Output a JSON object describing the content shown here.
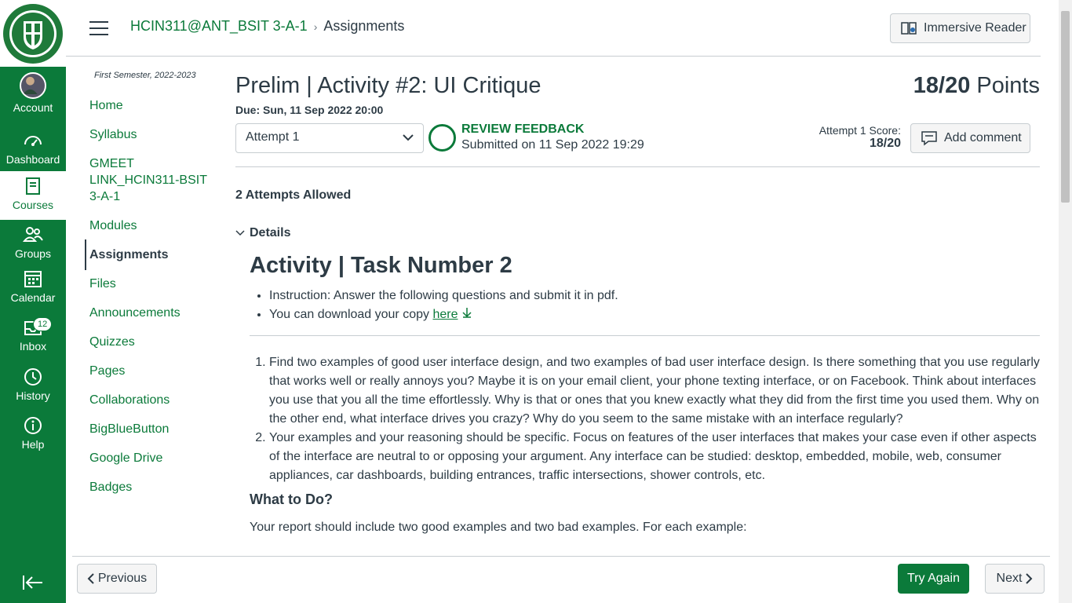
{
  "global_nav": {
    "items": [
      {
        "label": "Account",
        "icon": "avatar-icon"
      },
      {
        "label": "Dashboard",
        "icon": "dashboard-icon"
      },
      {
        "label": "Courses",
        "icon": "courses-icon"
      },
      {
        "label": "Groups",
        "icon": "groups-icon"
      },
      {
        "label": "Calendar",
        "icon": "calendar-icon"
      },
      {
        "label": "Inbox",
        "icon": "inbox-icon",
        "badge": "12"
      },
      {
        "label": "History",
        "icon": "history-icon"
      },
      {
        "label": "Help",
        "icon": "help-icon"
      }
    ],
    "active": "Courses",
    "accent": "#0b7a3a"
  },
  "breadcrumb": {
    "course": "HCIN311@ANT_BSIT 3-A-1",
    "page": "Assignments"
  },
  "immersive_reader": "Immersive Reader",
  "course_nav": {
    "term": "First Semester, 2022-2023",
    "items": [
      "Home",
      "Syllabus",
      "GMEET LINK_HCIN311-BSIT 3-A-1",
      "Modules",
      "Assignments",
      "Files",
      "Announcements",
      "Quizzes",
      "Pages",
      "Collaborations",
      "BigBlueButton",
      "Google Drive",
      "Badges"
    ],
    "active": "Assignments"
  },
  "assignment": {
    "title": "Prelim | Activity #2: UI Critique",
    "points_value": "18/20",
    "points_label": "Points",
    "due": "Due: Sun, 11 Sep 2022 20:00",
    "attempt_select": "Attempt 1",
    "review_feedback": "REVIEW FEEDBACK",
    "submitted": "Submitted on 11 Sep 2022 19:29",
    "attempt_score_label": "Attempt 1 Score:",
    "attempt_score_value": "18/20",
    "add_comment": "Add comment",
    "attempts_allowed": "2 Attempts Allowed",
    "details_label": "Details"
  },
  "content": {
    "heading": "Activity | Task Number 2",
    "bullets": [
      "Instruction: Answer the following questions and submit it in pdf.",
      "You can download your copy "
    ],
    "download_link": "here",
    "numbered": [
      "Find two examples of good user interface design, and two examples of bad user interface design. Is there something that you use regularly that works well or really annoys you? Maybe it is on your email client, your phone texting interface, or on Facebook. Think about interfaces you use that you all the time effortlessly. Why is that or ones that you knew exactly what they did from the first time you used them. Why on the other end, what interface drives you crazy? Why do you seem to the same mistake with an interface regularly?",
      "Your examples and your reasoning should be specific. Focus on features of the user interfaces that makes your case even if other aspects of the interface are neutral to or opposing your argument. Any interface can be studied: desktop, embedded, mobile, web, consumer appliances, car dashboards, building entrances, traffic intersections, shower controls, etc."
    ],
    "subheading": "What to Do?",
    "paragraph": "Your report should include two good examples and two bad examples. For each example:"
  },
  "footer": {
    "previous": "Previous",
    "try_again": "Try Again",
    "next": "Next"
  }
}
